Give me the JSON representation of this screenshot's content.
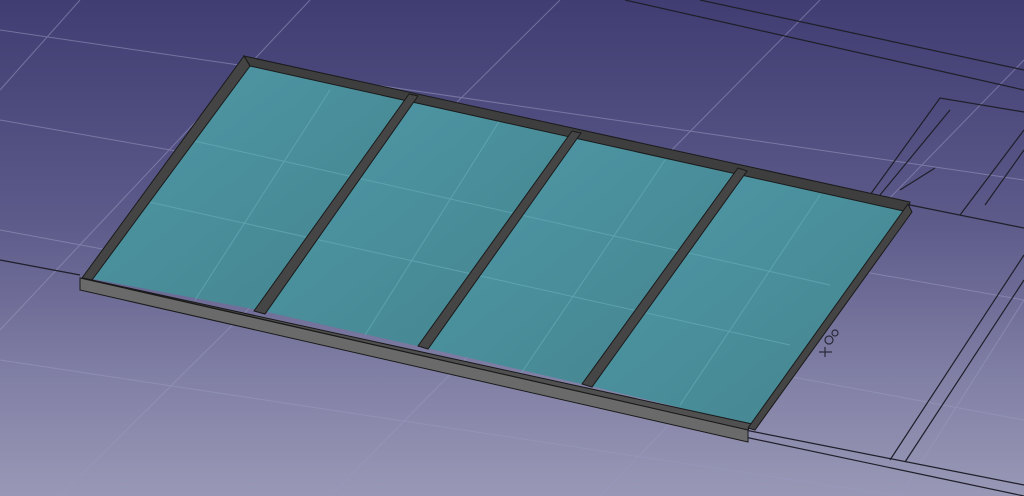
{
  "viewport": {
    "background_top": "#3f3d72",
    "background_bottom": "#9898b6"
  },
  "model": {
    "glass_color": "#4a8b9a",
    "frame_color": "#4a4a4a",
    "mullion_count": 3,
    "pane_count": 4
  },
  "placement_marker": {
    "icon": "dimension-marker-icon"
  }
}
